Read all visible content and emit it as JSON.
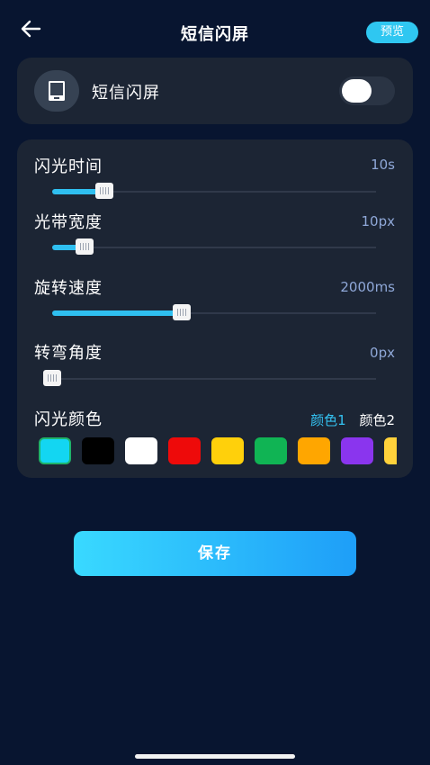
{
  "header": {
    "title": "短信闪屏",
    "preview_label": "预览"
  },
  "toggle_card": {
    "label": "短信闪屏",
    "enabled": false
  },
  "settings": {
    "flash_time": {
      "label": "闪光时间",
      "value": "10s",
      "fraction": 0.16
    },
    "band_width": {
      "label": "光带宽度",
      "value": "10px",
      "fraction": 0.1
    },
    "rotation_speed": {
      "label": "旋转速度",
      "value": "2000ms",
      "fraction": 0.4
    },
    "corner_angle": {
      "label": "转弯角度",
      "value": "0px",
      "fraction": 0.0
    },
    "flash_color": {
      "label": "闪光颜色",
      "tabs": [
        "颜色1",
        "颜色2"
      ],
      "active_tab": "颜色1",
      "swatches": [
        "#13d6f2",
        "#000000",
        "#ffffff",
        "#ee0a0a",
        "#ffd00b",
        "#10b454",
        "#ffa600",
        "#8a35ee",
        "#ffd13b"
      ],
      "selected_index": 0
    }
  },
  "save_label": "保存",
  "colors": {
    "accent": "#2fbff0",
    "background": "#081530",
    "card": "#1c2534"
  }
}
